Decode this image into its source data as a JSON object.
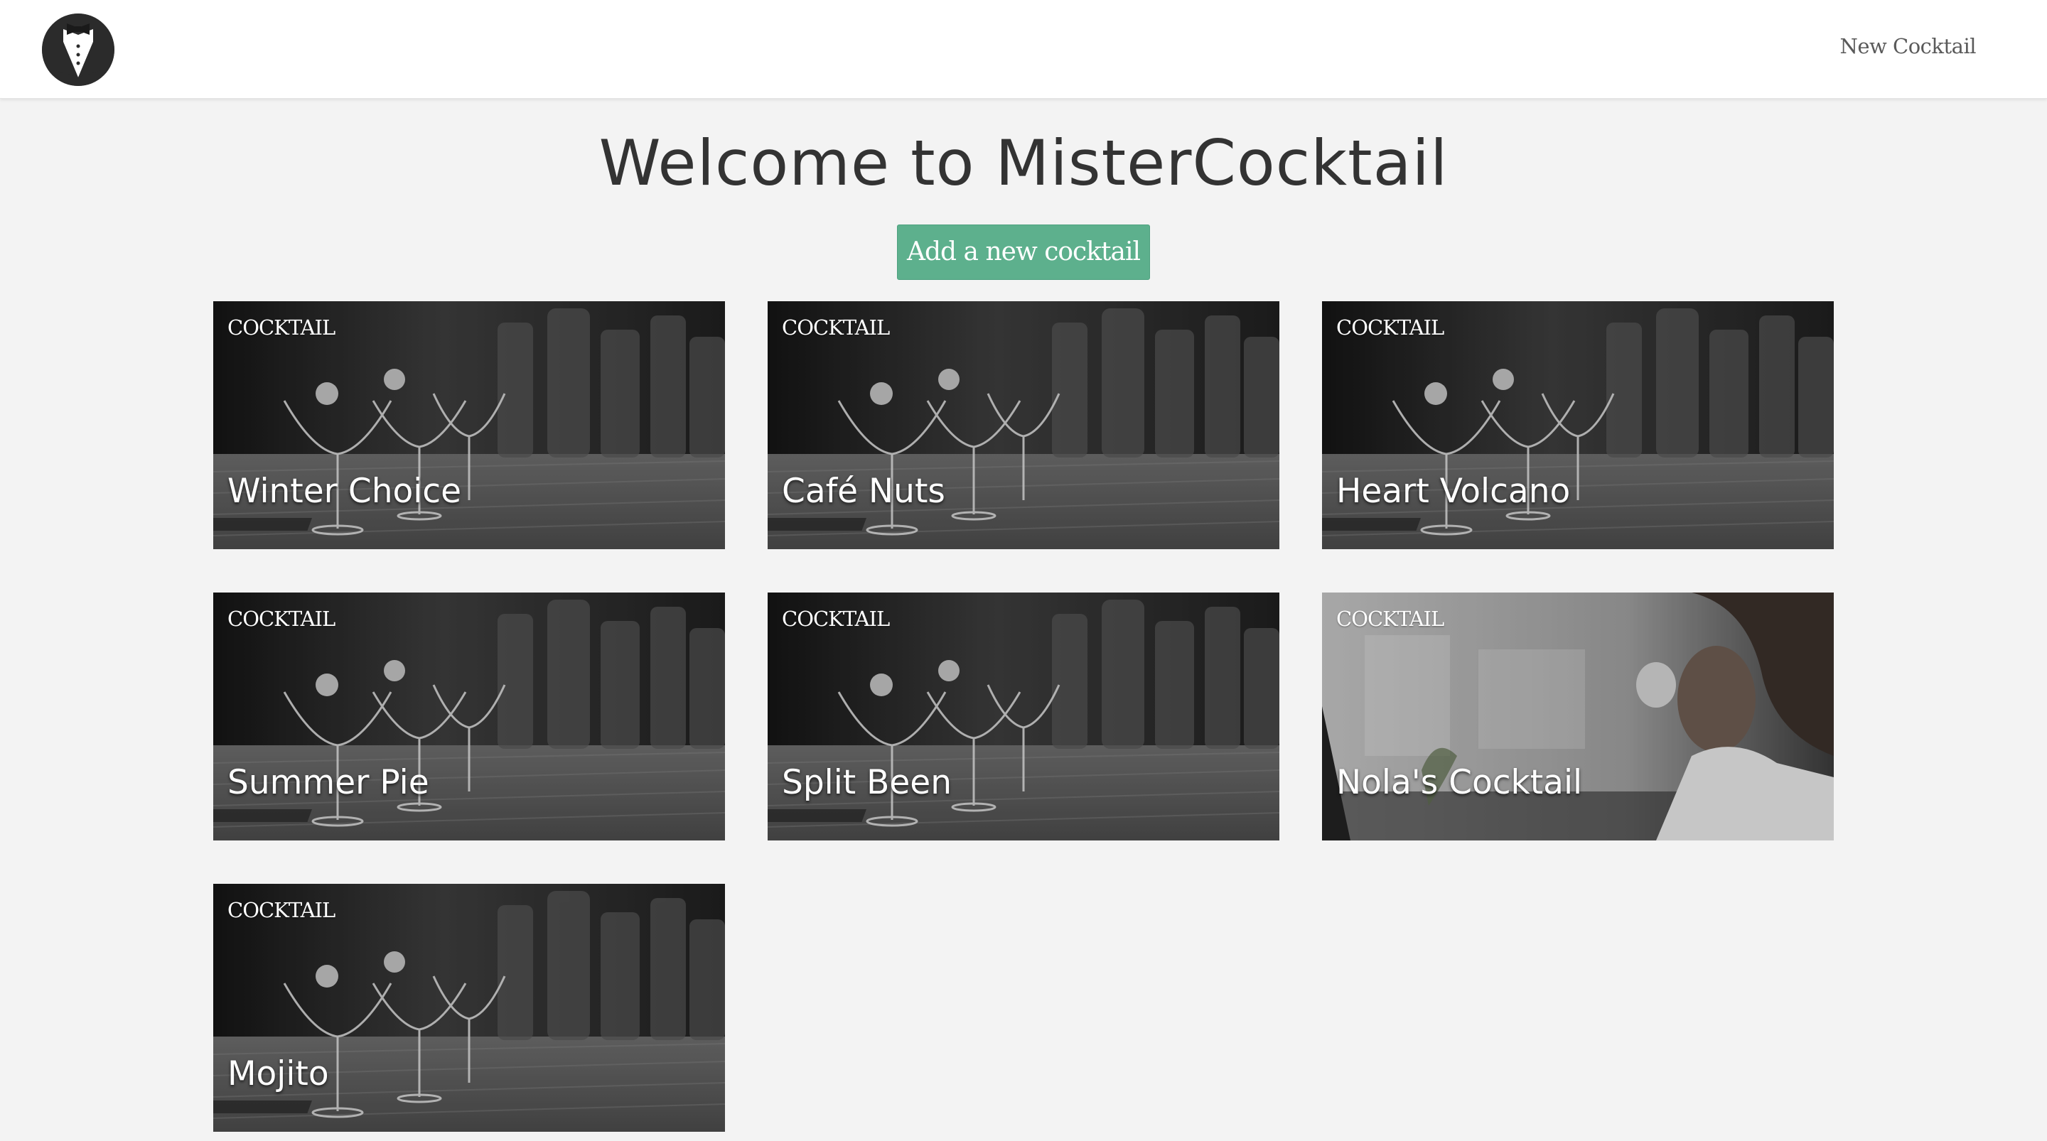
{
  "navbar": {
    "logo_icon": "tuxedo-bowtie-icon",
    "new_cocktail_link": "New Cocktail"
  },
  "main": {
    "title": "Welcome to MisterCocktail",
    "add_button": "Add a new cocktail",
    "accent_color": "#5db08d",
    "cards": [
      {
        "category": "COCKTAIL",
        "name": "Winter Choice",
        "image": "bar-glasses"
      },
      {
        "category": "COCKTAIL",
        "name": "Café Nuts",
        "image": "bar-glasses"
      },
      {
        "category": "COCKTAIL",
        "name": "Heart Volcano",
        "image": "bar-glasses"
      },
      {
        "category": "COCKTAIL",
        "name": "Summer Pie",
        "image": "bar-glasses"
      },
      {
        "category": "COCKTAIL",
        "name": "Split Been",
        "image": "bar-glasses"
      },
      {
        "category": "COCKTAIL",
        "name": "Nola's Cocktail",
        "image": "woman-coffee"
      },
      {
        "category": "COCKTAIL",
        "name": "Mojito",
        "image": "bar-glasses"
      }
    ]
  }
}
